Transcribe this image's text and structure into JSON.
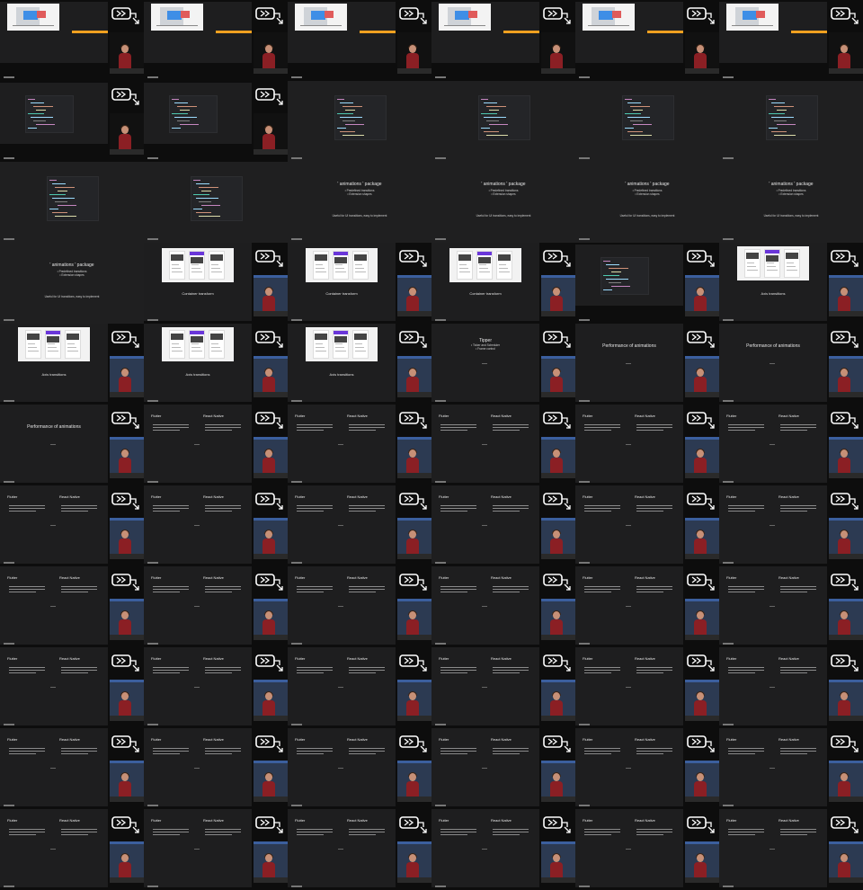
{
  "sheet": {
    "rows": 11,
    "cols": 6,
    "frames": 66
  },
  "colors": {
    "background": "#0b0b0b",
    "slide": "#1e1e1f",
    "accent_purple": "#6a36d9",
    "accent_orange": "#f0a020",
    "shirt": "#8b1f24"
  },
  "text": {
    "container_transform": "Container transform",
    "axis_transitions": "Axis transitions",
    "animations_package": "' animations ' package",
    "animations_sub": "• Predefined transitions\n• Extension shapes",
    "animations_note": "Useful for UI transitions, easy to implement",
    "performance": "Performance of animations",
    "flutter": "Flutter",
    "react_native": "React Native",
    "tipper": "Tipper",
    "tipper_sub": "• Ticker and Scheduler\n• Frame control"
  },
  "frames": [
    {
      "layout": "presenter",
      "content": "chart"
    },
    {
      "layout": "presenter",
      "content": "chart"
    },
    {
      "layout": "presenter",
      "content": "chart"
    },
    {
      "layout": "presenter",
      "content": "chart"
    },
    {
      "layout": "presenter",
      "content": "chart"
    },
    {
      "layout": "presenter",
      "content": "chart"
    },
    {
      "layout": "presenter",
      "content": "code"
    },
    {
      "layout": "presenter",
      "content": "code"
    },
    {
      "layout": "full",
      "content": "code"
    },
    {
      "layout": "full",
      "content": "code"
    },
    {
      "layout": "full",
      "content": "code"
    },
    {
      "layout": "full",
      "content": "code"
    },
    {
      "layout": "full",
      "content": "code"
    },
    {
      "layout": "full",
      "content": "code"
    },
    {
      "layout": "full",
      "content": "animations"
    },
    {
      "layout": "full",
      "content": "animations"
    },
    {
      "layout": "full",
      "content": "animations"
    },
    {
      "layout": "full",
      "content": "animations"
    },
    {
      "layout": "full",
      "content": "animations"
    },
    {
      "layout": "presenter",
      "content": "container"
    },
    {
      "layout": "presenter",
      "content": "container"
    },
    {
      "layout": "presenter",
      "content": "container"
    },
    {
      "layout": "presenter",
      "content": "codepad"
    },
    {
      "layout": "presenter",
      "content": "axis"
    },
    {
      "layout": "presenter",
      "content": "axis"
    },
    {
      "layout": "presenter",
      "content": "axis"
    },
    {
      "layout": "presenter",
      "content": "axis"
    },
    {
      "layout": "presenter",
      "content": "tipper"
    },
    {
      "layout": "presenter",
      "content": "performance"
    },
    {
      "layout": "presenter",
      "content": "performance"
    },
    {
      "layout": "presenter",
      "content": "performance"
    },
    {
      "layout": "presenter",
      "content": "compare"
    },
    {
      "layout": "presenter",
      "content": "compare"
    },
    {
      "layout": "presenter",
      "content": "compare"
    },
    {
      "layout": "presenter",
      "content": "compare"
    },
    {
      "layout": "presenter",
      "content": "compare"
    },
    {
      "layout": "presenter",
      "content": "compare"
    },
    {
      "layout": "presenter",
      "content": "compare"
    },
    {
      "layout": "presenter",
      "content": "compare"
    },
    {
      "layout": "presenter",
      "content": "compare"
    },
    {
      "layout": "presenter",
      "content": "compare"
    },
    {
      "layout": "presenter",
      "content": "compare"
    },
    {
      "layout": "presenter",
      "content": "compare"
    },
    {
      "layout": "presenter",
      "content": "compare"
    },
    {
      "layout": "presenter",
      "content": "compare"
    },
    {
      "layout": "presenter",
      "content": "compare"
    },
    {
      "layout": "presenter",
      "content": "compare"
    },
    {
      "layout": "presenter",
      "content": "compare"
    },
    {
      "layout": "presenter",
      "content": "compare"
    },
    {
      "layout": "presenter",
      "content": "compare"
    },
    {
      "layout": "presenter",
      "content": "compare"
    },
    {
      "layout": "presenter",
      "content": "compare"
    },
    {
      "layout": "presenter",
      "content": "compare"
    },
    {
      "layout": "presenter",
      "content": "compare"
    },
    {
      "layout": "presenter",
      "content": "compare"
    },
    {
      "layout": "presenter",
      "content": "compare"
    },
    {
      "layout": "presenter",
      "content": "compare"
    },
    {
      "layout": "presenter",
      "content": "compare"
    },
    {
      "layout": "presenter",
      "content": "compare"
    },
    {
      "layout": "presenter",
      "content": "compare"
    },
    {
      "layout": "presenter",
      "content": "compare"
    },
    {
      "layout": "presenter",
      "content": "compare"
    },
    {
      "layout": "presenter",
      "content": "compare"
    },
    {
      "layout": "presenter",
      "content": "compare"
    },
    {
      "layout": "presenter",
      "content": "compare"
    },
    {
      "layout": "presenter",
      "content": "compare"
    }
  ]
}
